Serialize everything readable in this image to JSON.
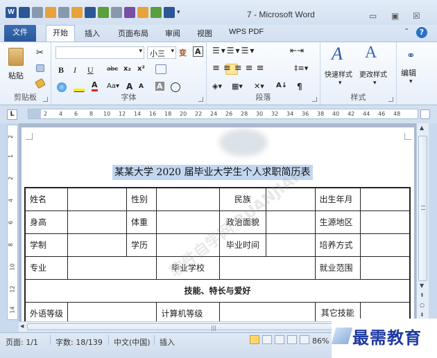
{
  "window": {
    "title": "7 - Microsoft Word",
    "minimize": "▭",
    "maximize": "▣",
    "close": "☒"
  },
  "tabs": [
    {
      "label": "文件"
    },
    {
      "label": "开始"
    },
    {
      "label": "插入"
    },
    {
      "label": "页面布局"
    },
    {
      "label": "审阅"
    },
    {
      "label": "视图"
    },
    {
      "label": "WPS PDF"
    }
  ],
  "ribbon": {
    "font_name": "",
    "font_size": "小三",
    "groups": {
      "clipboard": "剪贴板",
      "font": "字体",
      "paragraph": "段落",
      "styles": "样式"
    },
    "paste_label": "粘贴",
    "quick_styles_label": "快速样式",
    "change_styles_label": "更改样式",
    "edit_label": "编辑",
    "bold": "B",
    "italic": "I",
    "underline": "U",
    "strike": "abc",
    "subscript": "x₂",
    "superscript": "x²",
    "grow_font": "A",
    "shrink_font": "A",
    "char_border": "A",
    "pinyin": "变"
  },
  "ruler": {
    "numbers": [
      "2",
      "4",
      "6",
      "8",
      "10",
      "12",
      "14",
      "16",
      "18",
      "20",
      "22",
      "24",
      "26",
      "28",
      "30",
      "32",
      "34",
      "36",
      "38",
      "40",
      "42",
      "44",
      "46",
      "48"
    ],
    "tab_selector": "L"
  },
  "vruler": {
    "numbers": [
      "2",
      "1",
      "2",
      "4",
      "6",
      "8",
      "10",
      "12",
      "14"
    ]
  },
  "document": {
    "title": "某某大学 2020 届毕业大学生个人求职简历表",
    "watermark": "软件自学网 RUANJIAN",
    "rows": [
      [
        "姓名",
        "",
        "性别",
        "",
        "民族",
        "",
        "出生年月",
        ""
      ],
      [
        "身高",
        "",
        "体重",
        "",
        "政治面貌",
        "",
        "生源地区",
        ""
      ],
      [
        "学制",
        "",
        "学历",
        "",
        "毕业时间",
        "",
        "培养方式",
        ""
      ],
      [
        "专业",
        "",
        "毕业学校",
        "",
        "就业范围",
        ""
      ]
    ],
    "section_header": "技能、特长与爱好",
    "last_row": [
      "外语等级",
      "",
      "计算机等级",
      "",
      "其它技能",
      ""
    ]
  },
  "status": {
    "page": "页面: 1/1",
    "words": "字数: 18/139",
    "language": "中文(中国)",
    "insert": "插入",
    "zoom": "86%"
  },
  "brand": {
    "text": "最需教育"
  }
}
